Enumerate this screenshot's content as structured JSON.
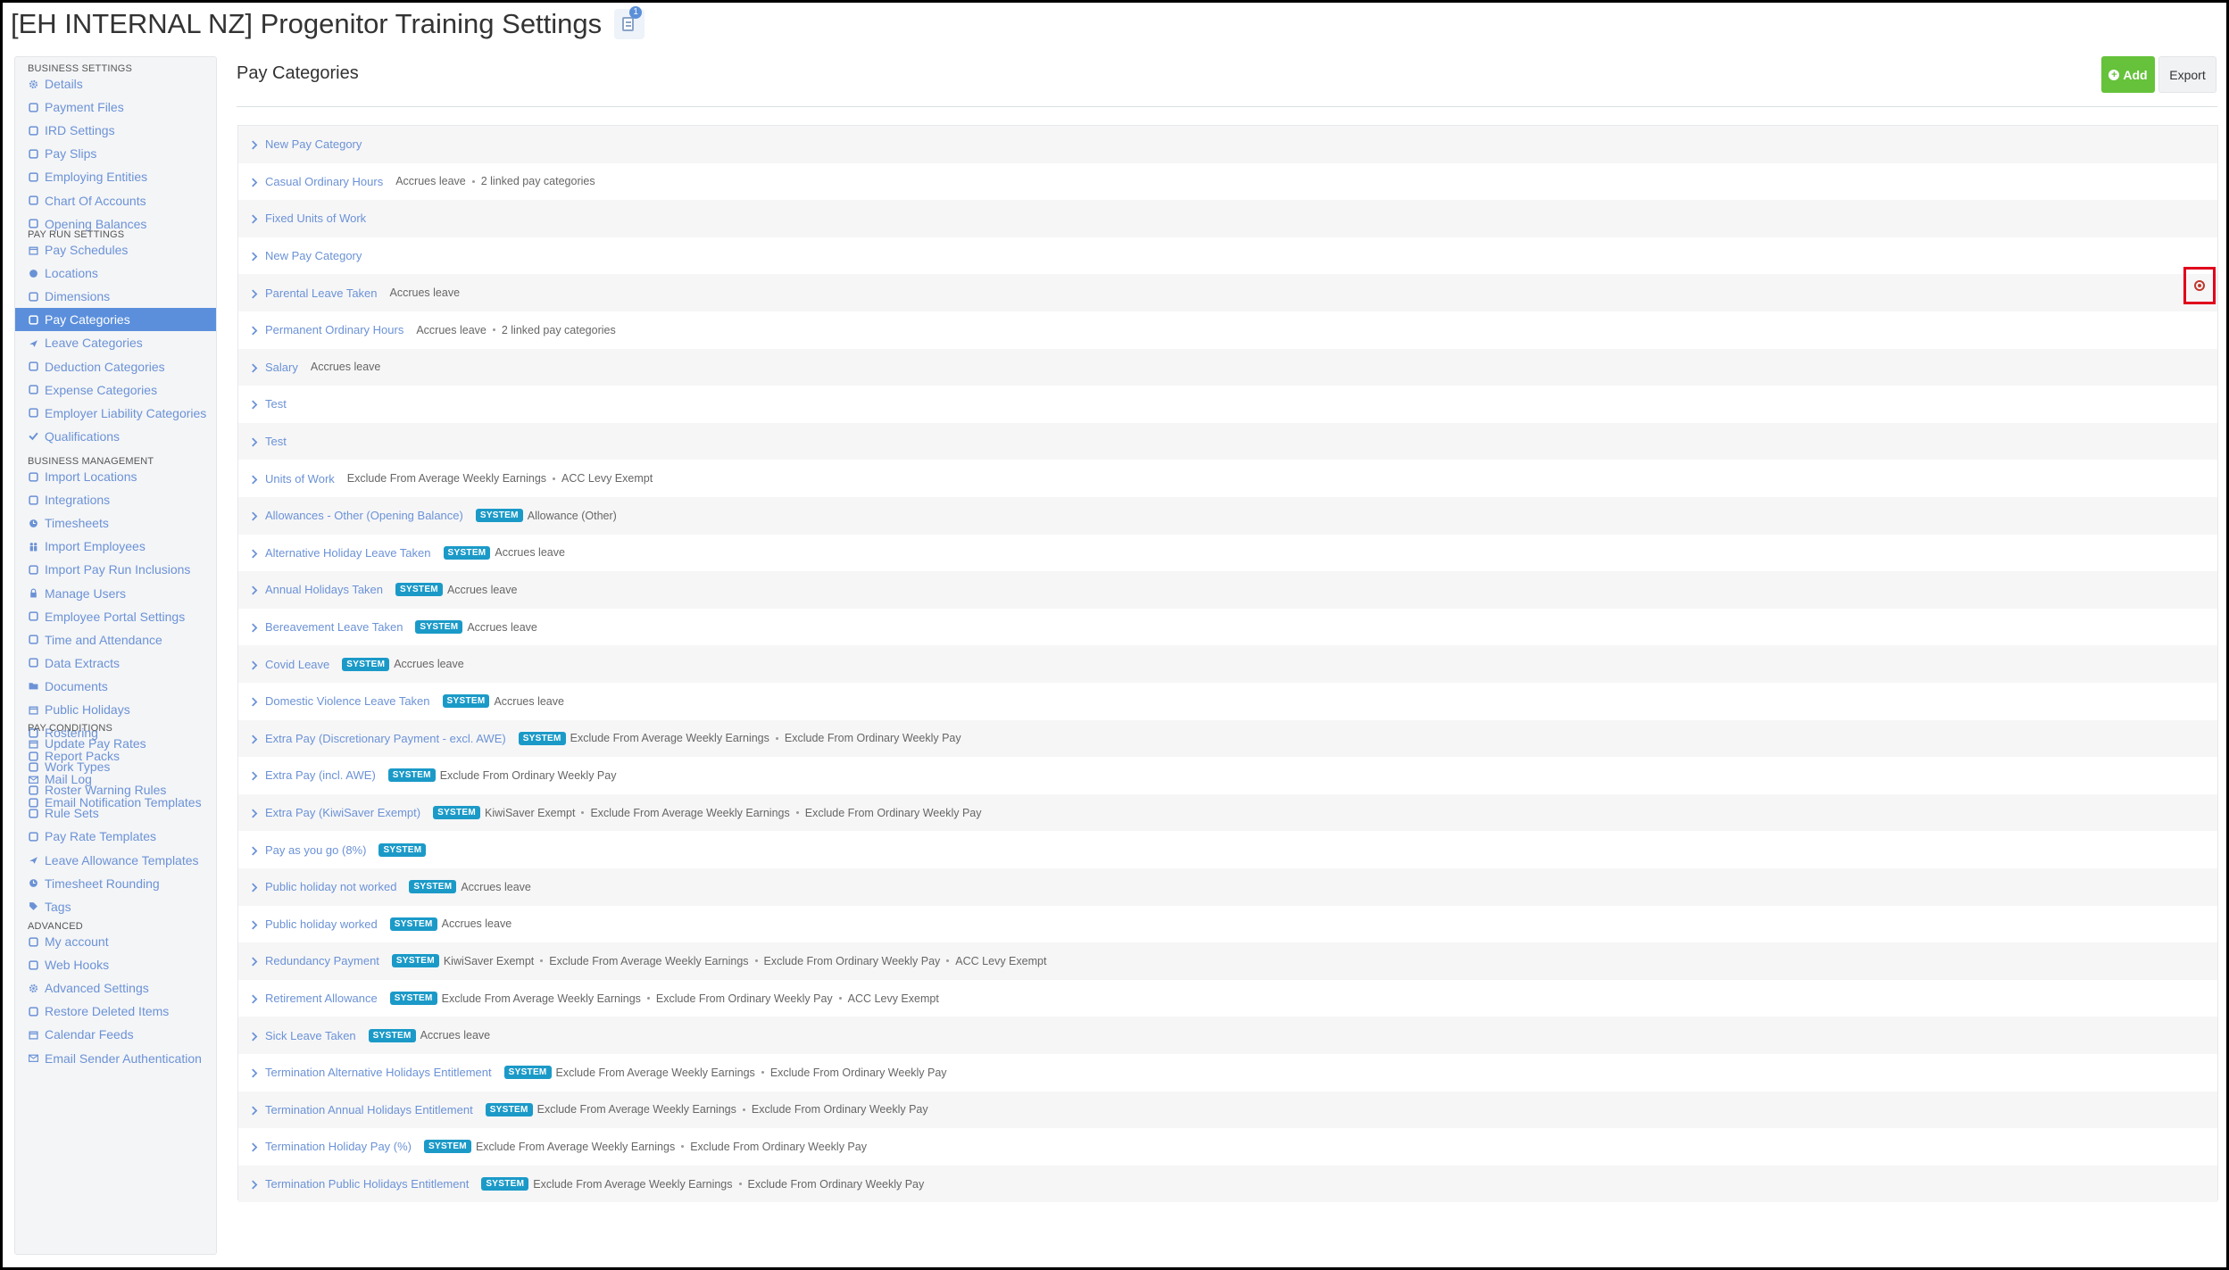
{
  "page": {
    "title": "[EH INTERNAL NZ] Progenitor Training Settings",
    "notification_count": "1"
  },
  "sidebar": {
    "sections": [
      {
        "heading": "BUSINESS SETTINGS",
        "items": [
          {
            "label": "Details",
            "icon": "gear-icon"
          },
          {
            "label": "Payment Files",
            "icon": "file-icon"
          },
          {
            "label": "IRD Settings",
            "icon": "balance-scale-icon"
          },
          {
            "label": "Pay Slips",
            "icon": "document-icon"
          },
          {
            "label": "Employing Entities",
            "icon": "building-icon"
          },
          {
            "label": "Chart Of Accounts",
            "icon": "list-icon"
          },
          {
            "label": "Opening Balances",
            "icon": "calculator-icon"
          }
        ]
      },
      {
        "heading": "PAY RUN SETTINGS",
        "items": [
          {
            "label": "Pay Schedules",
            "icon": "calendar-icon"
          },
          {
            "label": "Locations",
            "icon": "globe-icon"
          },
          {
            "label": "Dimensions",
            "icon": "chart-icon"
          },
          {
            "label": "Pay Categories",
            "icon": "money-icon",
            "active": true
          },
          {
            "label": "Leave Categories",
            "icon": "plane-icon"
          },
          {
            "label": "Deduction Categories",
            "icon": "minus-circle-icon"
          },
          {
            "label": "Expense Categories",
            "icon": "dollar-circle-icon"
          },
          {
            "label": "Employer Liability Categories",
            "icon": "bar-chart-icon"
          },
          {
            "label": "Qualifications",
            "icon": "check-icon"
          }
        ]
      },
      {
        "heading": "BUSINESS MANAGEMENT",
        "items": [
          {
            "label": "Import Locations",
            "icon": "map-pin-icon"
          },
          {
            "label": "Integrations",
            "icon": "plug-icon"
          },
          {
            "label": "Timesheets",
            "icon": "clock-icon"
          },
          {
            "label": "Import Employees",
            "icon": "users-icon"
          },
          {
            "label": "Import Pay Run Inclusions",
            "icon": "refresh-icon"
          },
          {
            "label": "Manage Users",
            "icon": "lock-icon"
          },
          {
            "label": "Employee Portal Settings",
            "icon": "pencil-icon"
          },
          {
            "label": "Time and Attendance",
            "icon": "headset-icon"
          },
          {
            "label": "Data Extracts",
            "icon": "cloud-download-icon"
          },
          {
            "label": "Documents",
            "icon": "folder-icon"
          },
          {
            "label": "Public Holidays",
            "icon": "calendar-icon"
          },
          {
            "label": "Rostering",
            "icon": "calendar-grid-icon"
          },
          {
            "label": "Report Packs",
            "icon": "folder-open-icon"
          },
          {
            "label": "Mail Log",
            "icon": "envelope-icon"
          },
          {
            "label": "Email Notification Templates",
            "icon": "envelope-open-icon"
          }
        ]
      },
      {
        "heading": "PAY CONDITIONS",
        "items": [
          {
            "label": "Update Pay Rates",
            "icon": "calendar-icon"
          },
          {
            "label": "Work Types",
            "icon": "camera-icon"
          },
          {
            "label": "Roster Warning Rules",
            "icon": "sliders-icon"
          },
          {
            "label": "Rule Sets",
            "icon": "gavel-icon"
          },
          {
            "label": "Pay Rate Templates",
            "icon": "money-icon"
          },
          {
            "label": "Leave Allowance Templates",
            "icon": "plane-icon"
          },
          {
            "label": "Timesheet Rounding",
            "icon": "clock-icon"
          },
          {
            "label": "Tags",
            "icon": "tag-icon"
          }
        ]
      },
      {
        "heading": "ADVANCED",
        "items": [
          {
            "label": "My account",
            "icon": "user-circle-icon"
          },
          {
            "label": "Web Hooks",
            "icon": "cloud-icon"
          },
          {
            "label": "Advanced Settings",
            "icon": "gear-icon"
          },
          {
            "label": "Restore Deleted Items",
            "icon": "refresh-icon"
          },
          {
            "label": "Calendar Feeds",
            "icon": "calendar-icon"
          },
          {
            "label": "Email Sender Authentication",
            "icon": "envelope-icon"
          }
        ]
      }
    ]
  },
  "main": {
    "title": "Pay Categories",
    "add_label": "Add",
    "export_label": "Export",
    "system_badge": "SYSTEM",
    "rows": [
      {
        "name": "New Pay Category",
        "system": false,
        "tags": []
      },
      {
        "name": "Casual Ordinary Hours",
        "system": false,
        "tags": [
          "Accrues leave",
          "2 linked pay categories"
        ]
      },
      {
        "name": "Fixed Units of Work",
        "system": false,
        "tags": []
      },
      {
        "name": "New Pay Category",
        "system": false,
        "tags": []
      },
      {
        "name": "Parental Leave Taken",
        "system": false,
        "tags": [
          "Accrues leave"
        ]
      },
      {
        "name": "Permanent Ordinary Hours",
        "system": false,
        "tags": [
          "Accrues leave",
          "2 linked pay categories"
        ]
      },
      {
        "name": "Salary",
        "system": false,
        "tags": [
          "Accrues leave"
        ]
      },
      {
        "name": "Test",
        "system": false,
        "tags": []
      },
      {
        "name": "Test",
        "system": false,
        "tags": []
      },
      {
        "name": "Units of Work",
        "system": false,
        "tags": [
          "Exclude From Average Weekly Earnings",
          "ACC Levy Exempt"
        ]
      },
      {
        "name": "Allowances - Other (Opening Balance)",
        "system": true,
        "tags": [
          "Allowance (Other)"
        ]
      },
      {
        "name": "Alternative Holiday Leave Taken",
        "system": true,
        "tags": [
          "Accrues leave"
        ]
      },
      {
        "name": "Annual Holidays Taken",
        "system": true,
        "tags": [
          "Accrues leave"
        ]
      },
      {
        "name": "Bereavement Leave Taken",
        "system": true,
        "tags": [
          "Accrues leave"
        ]
      },
      {
        "name": "Covid Leave",
        "system": true,
        "tags": [
          "Accrues leave"
        ]
      },
      {
        "name": "Domestic Violence Leave Taken",
        "system": true,
        "tags": [
          "Accrues leave"
        ]
      },
      {
        "name": "Extra Pay (Discretionary Payment - excl. AWE)",
        "system": true,
        "tags": [
          "Exclude From Average Weekly Earnings",
          "Exclude From Ordinary Weekly Pay"
        ]
      },
      {
        "name": "Extra Pay (incl. AWE)",
        "system": true,
        "tags": [
          "Exclude From Ordinary Weekly Pay"
        ]
      },
      {
        "name": "Extra Pay (KiwiSaver Exempt)",
        "system": true,
        "tags": [
          "KiwiSaver Exempt",
          "Exclude From Average Weekly Earnings",
          "Exclude From Ordinary Weekly Pay"
        ]
      },
      {
        "name": "Pay as you go (8%)",
        "system": true,
        "tags": []
      },
      {
        "name": "Public holiday not worked",
        "system": true,
        "tags": [
          "Accrues leave"
        ]
      },
      {
        "name": "Public holiday worked",
        "system": true,
        "tags": [
          "Accrues leave"
        ]
      },
      {
        "name": "Redundancy Payment",
        "system": true,
        "tags": [
          "KiwiSaver Exempt",
          "Exclude From Average Weekly Earnings",
          "Exclude From Ordinary Weekly Pay",
          "ACC Levy Exempt"
        ]
      },
      {
        "name": "Retirement Allowance",
        "system": true,
        "tags": [
          "Exclude From Average Weekly Earnings",
          "Exclude From Ordinary Weekly Pay",
          "ACC Levy Exempt"
        ]
      },
      {
        "name": "Sick Leave Taken",
        "system": true,
        "tags": [
          "Accrues leave"
        ]
      },
      {
        "name": "Termination Alternative Holidays Entitlement",
        "system": true,
        "tags": [
          "Exclude From Average Weekly Earnings",
          "Exclude From Ordinary Weekly Pay"
        ]
      },
      {
        "name": "Termination Annual Holidays Entitlement",
        "system": true,
        "tags": [
          "Exclude From Average Weekly Earnings",
          "Exclude From Ordinary Weekly Pay"
        ]
      },
      {
        "name": "Termination Holiday Pay (%)",
        "system": true,
        "tags": [
          "Exclude From Average Weekly Earnings",
          "Exclude From Ordinary Weekly Pay"
        ]
      },
      {
        "name": "Termination Public Holidays Entitlement",
        "system": true,
        "tags": [
          "Exclude From Average Weekly Earnings",
          "Exclude From Ordinary Weekly Pay"
        ]
      }
    ]
  },
  "colors": {
    "accent": "#5b8fdc",
    "link": "#6b92d6",
    "add_button": "#65c23a",
    "system_badge": "#1b9ac8",
    "highlight_box": "#e0001b"
  }
}
